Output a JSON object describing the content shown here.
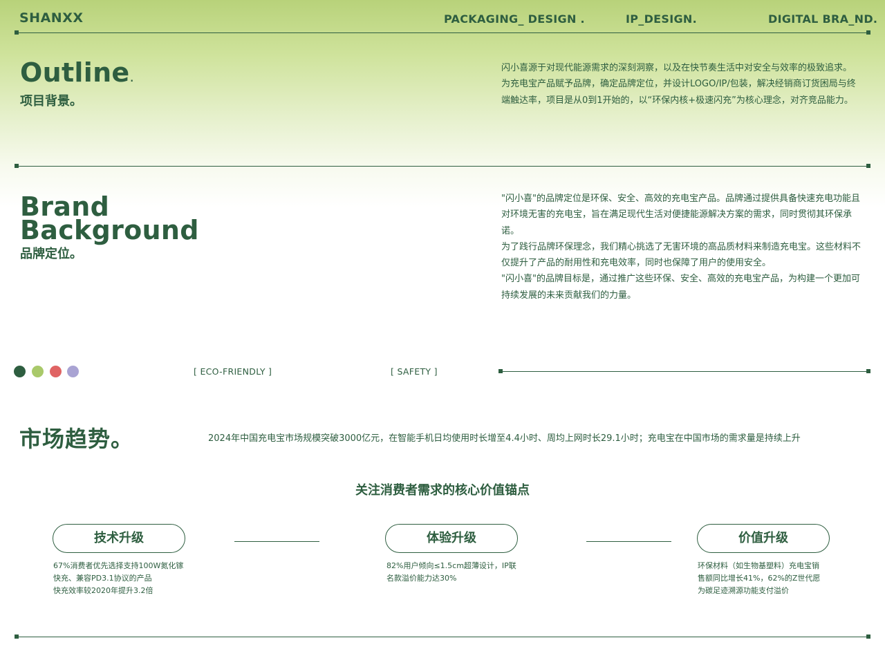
{
  "header": {
    "logo": "SHANXX",
    "nav": [
      "PACKAGING_ DESIGN .",
      "IP_DESIGN.",
      "DIGITAL BRA_ND."
    ]
  },
  "outline": {
    "title": "Outline",
    "title_dot": ".",
    "subtitle": "项目背景。",
    "paragraphs": [
      "闪小喜源于对现代能源需求的深刻洞察，以及在快节奏生活中对安全与效率的极致追求。",
      "为充电宝产品赋予品牌，确定品牌定位，并设计LOGO/IP/包装，解决经销商订货困局与终端触达率，项目是从0到1开始的，以“环保内核+极速闪充”为核心理念，对齐竞品能力。"
    ]
  },
  "brand": {
    "title_line1": "Brand",
    "title_line2": "Background",
    "subtitle": "品牌定位。",
    "paragraphs": [
      "\"闪小喜\"的品牌定位是环保、安全、高效的充电宝产品。品牌通过提供具备快速充电功能且对环境无害的充电宝，旨在满足现代生活对便捷能源解决方案的需求，同时贯彻其环保承诺。",
      "为了践行品牌环保理念，我们精心挑选了无害环境的高品质材料来制造充电宝。这些材料不仅提升了产品的耐用性和充电效率，同时也保障了用户的使用安全。",
      "\"闪小喜\"的品牌目标是，通过推广这些环保、安全、高效的充电宝产品，为构建一个更加可持续发展的未来贡献我们的力量。"
    ]
  },
  "palette": {
    "colors": [
      "#2e5e40",
      "#a9c96a",
      "#e06464",
      "#a9a3d3"
    ],
    "tags": [
      "[ ECO-FRIENDLY ]",
      "[ SAFETY ]"
    ]
  },
  "market": {
    "title": "市场趋势。",
    "text": "2024年中国充电宝市场规模突破3000亿元，在智能手机日均使用时长增至4.4小时、周均上网时长29.1小时；充电宝在中国市场的需求量是持续上升"
  },
  "anchors": {
    "title": "关注消费者需求的核心价值锚点",
    "items": [
      {
        "label": "技术升级",
        "desc": [
          "67%消费者优先选择支持100W氮化镓",
          "快充、兼容PD3.1协议的产品",
          "快充效率较2020年提升3.2倍"
        ]
      },
      {
        "label": "体验升级",
        "desc": [
          "82%用户倾向≤1.5cm超薄设计，IP联",
          "名款溢价能力达30%"
        ]
      },
      {
        "label": "价值升级",
        "desc": [
          "环保材料（如生物基塑料）充电宝销",
          "售额同比增长41%，62%的Z世代愿",
          "为碳足迹溯源功能支付溢价"
        ]
      }
    ]
  }
}
